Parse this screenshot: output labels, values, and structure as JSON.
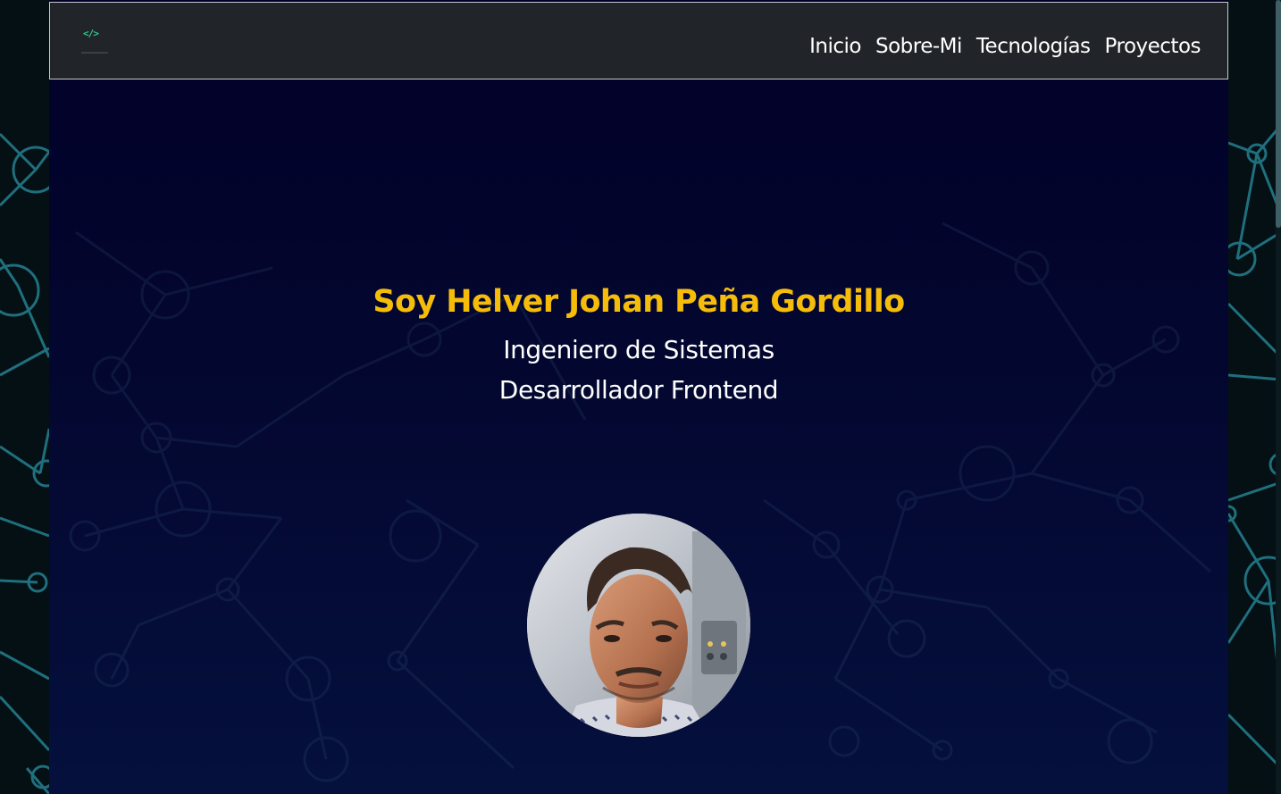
{
  "navbar": {
    "logo_icon": "code-brackets-logo",
    "logo_text": "</>",
    "links": [
      "Inicio",
      "Sobre-Mi",
      "Tecnologías",
      "Proyectos"
    ]
  },
  "hero": {
    "title": "Soy Helver Johan Peña Gordillo",
    "role_1": "Ingeniero de Sistemas",
    "role_2": "Desarrollador Frontend"
  },
  "colors": {
    "title_accent": "#f5bd0a",
    "navbar_bg": "#212529",
    "page_bg": "#020029",
    "network_lines": "#1d6f7d"
  }
}
